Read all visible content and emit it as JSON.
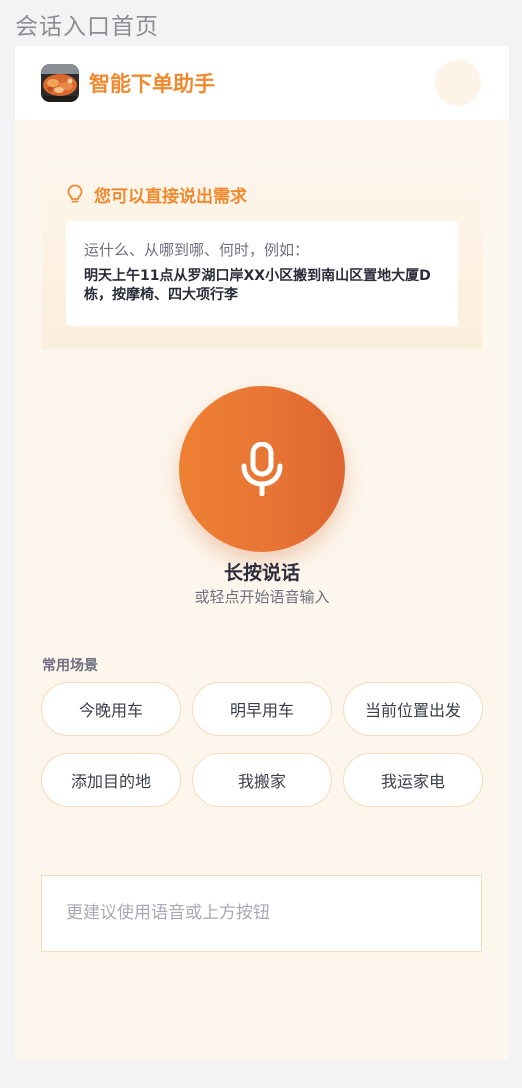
{
  "page": {
    "label": "会话入口首页"
  },
  "header": {
    "title": "智能下单助手",
    "logo_icon": "food-photo-logo",
    "accent_color": "#ef8a2e"
  },
  "tip": {
    "icon": "lightbulb-icon",
    "title": "您可以直接说出需求",
    "intro": "运什么、从哪到哪、何时，例如：",
    "example": "明天上午11点从罗湖口岸XX小区搬到南山区置地大厦D栋，按摩椅、四大项行李"
  },
  "voice": {
    "icon": "microphone-icon",
    "label": "长按说话",
    "sub_label": "或轻点开始语音输入"
  },
  "scenes": {
    "title": "常用场景",
    "items": [
      {
        "label": "今晚用车"
      },
      {
        "label": "明早用车"
      },
      {
        "label": "当前位置出发"
      },
      {
        "label": "添加目的地"
      },
      {
        "label": "我搬家"
      },
      {
        "label": "我运家电"
      }
    ]
  },
  "input": {
    "value": "",
    "placeholder": "更建议使用语音或上方按钮"
  }
}
